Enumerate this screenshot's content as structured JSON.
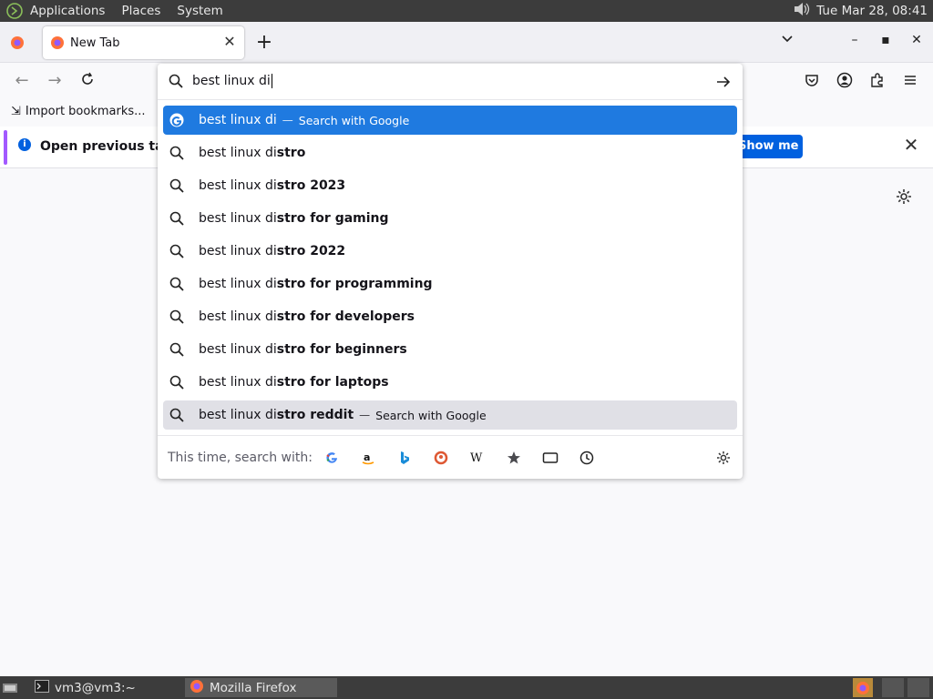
{
  "system_panel": {
    "menus": [
      "Applications",
      "Places",
      "System"
    ],
    "datetime": "Tue Mar 28, 08:41"
  },
  "tabs": {
    "active_title": "New Tab"
  },
  "bookmarks": {
    "import_label": "Import bookmarks..."
  },
  "notification": {
    "message": "Open previous tabs",
    "button_label": "Show me how"
  },
  "urlbar": {
    "input_value": "best linux di",
    "results": [
      {
        "typed": "best linux di",
        "completion": "",
        "action": "Search with Google",
        "icon": "google-icon",
        "state": "selected"
      },
      {
        "typed": "best linux di",
        "completion": "stro",
        "action": "",
        "icon": "search-icon",
        "state": ""
      },
      {
        "typed": "best linux di",
        "completion": "stro 2023",
        "action": "",
        "icon": "search-icon",
        "state": ""
      },
      {
        "typed": "best linux di",
        "completion": "stro for gaming",
        "action": "",
        "icon": "search-icon",
        "state": ""
      },
      {
        "typed": "best linux di",
        "completion": "stro 2022",
        "action": "",
        "icon": "search-icon",
        "state": ""
      },
      {
        "typed": "best linux di",
        "completion": "stro for programming",
        "action": "",
        "icon": "search-icon",
        "state": ""
      },
      {
        "typed": "best linux di",
        "completion": "stro for developers",
        "action": "",
        "icon": "search-icon",
        "state": ""
      },
      {
        "typed": "best linux di",
        "completion": "stro for beginners",
        "action": "",
        "icon": "search-icon",
        "state": ""
      },
      {
        "typed": "best linux di",
        "completion": "stro for laptops",
        "action": "",
        "icon": "search-icon",
        "state": ""
      },
      {
        "typed": "best linux di",
        "completion": "stro reddit",
        "action": "Search with Google",
        "icon": "search-icon",
        "state": "hover"
      }
    ],
    "separator": "—",
    "oneoff_label": "This time, search with:",
    "oneoff_engines": [
      "google-icon",
      "amazon-icon",
      "bing-icon",
      "duckduckgo-icon",
      "wikipedia-icon",
      "bookmarks-star-icon",
      "tabs-icon",
      "history-clock-icon"
    ]
  },
  "taskbar": {
    "terminal_label": "vm3@vm3:~",
    "firefox_label": "Mozilla Firefox"
  },
  "colors": {
    "selected_row": "#1f7ae0",
    "hover_row": "#e0e0e6",
    "notif_button": "#0060df"
  }
}
